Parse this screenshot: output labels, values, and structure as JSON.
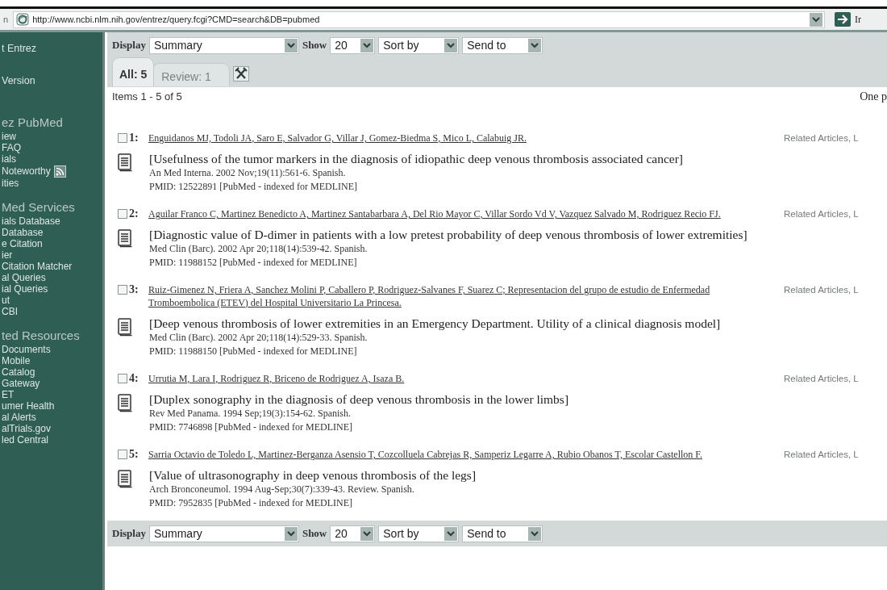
{
  "browser": {
    "address_label": "n",
    "url": "http://www.ncbi.nlm.nih.gov/entrez/query.fcgi?CMD=search&DB=pubmed",
    "go_label": "Ir"
  },
  "sidebar": {
    "items": [
      {
        "text": "t Entrez",
        "kind": "top"
      },
      {
        "text": "Version",
        "kind": "top"
      },
      {
        "text": "ez PubMed",
        "kind": "heading"
      },
      {
        "text": "iew",
        "kind": "link"
      },
      {
        "text": "FAQ",
        "kind": "link"
      },
      {
        "text": "ials",
        "kind": "link"
      },
      {
        "text": "Noteworthy",
        "kind": "feed"
      },
      {
        "text": "ities",
        "kind": "link"
      },
      {
        "text": "Med Services",
        "kind": "heading"
      },
      {
        "text": "ials Database",
        "kind": "link"
      },
      {
        "text": "Database",
        "kind": "link"
      },
      {
        "text": "e Citation",
        "kind": "link"
      },
      {
        "text": "ier",
        "kind": "link"
      },
      {
        "text": "Citation Matcher",
        "kind": "link"
      },
      {
        "text": "al Queries",
        "kind": "link"
      },
      {
        "text": "ial Queries",
        "kind": "link"
      },
      {
        "text": "ut",
        "kind": "link"
      },
      {
        "text": "CBI",
        "kind": "link"
      },
      {
        "text": "ted Resources",
        "kind": "heading"
      },
      {
        "text": "Documents",
        "kind": "link"
      },
      {
        "text": "Mobile",
        "kind": "link"
      },
      {
        "text": "Catalog",
        "kind": "link"
      },
      {
        "text": "Gateway",
        "kind": "link"
      },
      {
        "text": "ET",
        "kind": "link"
      },
      {
        "text": "umer Health",
        "kind": "link"
      },
      {
        "text": "al Alerts",
        "kind": "link"
      },
      {
        "text": "alTrials.gov",
        "kind": "link"
      },
      {
        "text": "led Central",
        "kind": "link"
      }
    ]
  },
  "toolbar_top": {
    "display_label": "Display",
    "display": "Summary",
    "show_label": "Show",
    "show": "20",
    "sort": "Sort by",
    "send": "Send to"
  },
  "tabs": [
    {
      "label": "All: 5",
      "selected": true
    },
    {
      "label": "Review: 1",
      "selected": false
    }
  ],
  "items_count": "Items 1 - 5 of 5",
  "page_info": "One p",
  "results": [
    {
      "checked": false,
      "number": "1:",
      "authors": "Enguidanos MJ, Todoli JA, Saro E, Salvador G, Villar J, Gomez-Biedma S, Mico L, Calabuig JR.",
      "related": "Related Articles, L",
      "title": "[Usefulness of the tumor markers in the diagnosis of idiopathic deep venous thrombosis associated cancer]",
      "source": "An Med Interna. 2002 Nov;19(11):561-6. Spanish.",
      "pmid": "PMID: 12522891 [PubMed - indexed for MEDLINE]"
    },
    {
      "checked": false,
      "number": "2:",
      "authors": "Aguilar Franco C, Martinez Benedicto A, Martinez Santabarbara A, Del Rio Mayor C, Villar Sordo Vd V, Vazquez Salvado M, Rodriguez Recio FJ.",
      "related": "Related Articles, L",
      "title": "[Diagnostic value of D-dimer in patients with a low pretest probability of deep venous thrombosis of lower extremities]",
      "source": "Med Clin (Barc). 2002 Apr 20;118(14):539-42. Spanish.",
      "pmid": "PMID: 11988152 [PubMed - indexed for MEDLINE]"
    },
    {
      "checked": false,
      "number": "3:",
      "authors": "Ruiz-Gimenez N, Friera A, Sanchez Molini P, Caballero P, Rodriguez-Salvanes F, Suarez C; Representacion del grupo de estudio de Enfermedad Tromboembolica (ETEV) del Hospital Universitario La Princesa.",
      "related": "Related Articles, L",
      "title": "[Deep venous thrombosis of lower extremities in an Emergency Department. Utility of a clinical diagnosis model]",
      "source": "Med Clin (Barc). 2002 Apr 20;118(14):529-33. Spanish.",
      "pmid": "PMID: 11988150 [PubMed - indexed for MEDLINE]"
    },
    {
      "checked": false,
      "number": "4:",
      "authors": "Urrutia M, Lara I, Rodriguez R, Briceno de Rodriguez A, Isaza B.",
      "related": "Related Articles, L",
      "title": "[Duplex sonography in the diagnosis of deep venous thrombosis in the lower limbs]",
      "source": "Rev Med Panama. 1994 Sep;19(3):154-62. Spanish.",
      "pmid": "PMID: 7746898 [PubMed - indexed for MEDLINE]"
    },
    {
      "checked": false,
      "number": "5:",
      "authors": "Sarria Octavio de Toledo L, Martinez-Berganza Asensio T, Cozcolluela Cabrejas R, Samperiz Legarre A, Rubio Obanos T, Escolar Castellon F.",
      "related": "Related Articles, L",
      "title": "[Value of ultrasonography in deep venous thrombosis of the legs]",
      "source": "Arch Bronconeumol. 1994 Aug-Sep;30(7):339-43. Review. Spanish.",
      "pmid": "PMID: 7952835 [PubMed - indexed for MEDLINE]"
    }
  ],
  "toolbar_bottom": {
    "display_label": "Display",
    "display": "Summary",
    "show_label": "Show",
    "show": "20",
    "sort": "Sort by",
    "send": "Send to"
  }
}
